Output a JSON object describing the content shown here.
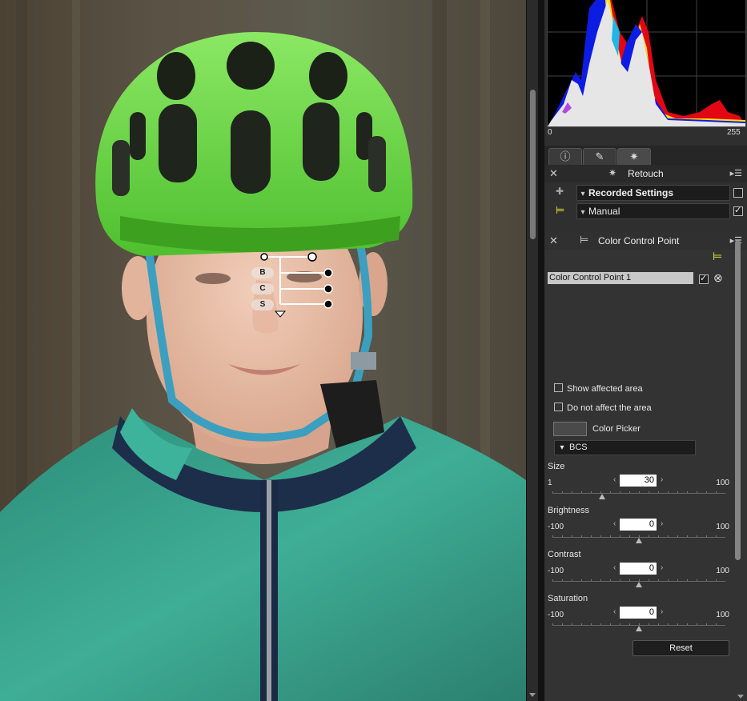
{
  "histogram": {
    "min_label": "0",
    "max_label": "255"
  },
  "tabs": [
    {
      "name": "info",
      "icon": "info-icon"
    },
    {
      "name": "adjust",
      "icon": "edit-icon"
    },
    {
      "name": "retouch",
      "icon": "wand-icon"
    }
  ],
  "retouch_header": {
    "title": "Retouch"
  },
  "recorded": {
    "label": "Recorded Settings",
    "checked": false
  },
  "manual": {
    "label": "Manual",
    "checked": true
  },
  "ccp_header": {
    "title": "Color Control Point"
  },
  "ccp_item": {
    "name": "Color Control Point 1",
    "enabled": true
  },
  "overlay_labels": {
    "b": "B",
    "c": "C",
    "s": "S"
  },
  "options": {
    "show_affected": "Show affected area",
    "do_not_affect": "Do not affect the area"
  },
  "color_picker": {
    "label": "Color Picker"
  },
  "mode": {
    "label": "BCS"
  },
  "sliders": {
    "size": {
      "label": "Size",
      "value": "30",
      "min": "1",
      "max": "100"
    },
    "brightness": {
      "label": "Brightness",
      "value": "0",
      "min": "-100",
      "max": "100"
    },
    "contrast": {
      "label": "Contrast",
      "value": "0",
      "min": "-100",
      "max": "100"
    },
    "saturation": {
      "label": "Saturation",
      "value": "0",
      "min": "-100",
      "max": "100"
    }
  },
  "reset_label": "Reset"
}
